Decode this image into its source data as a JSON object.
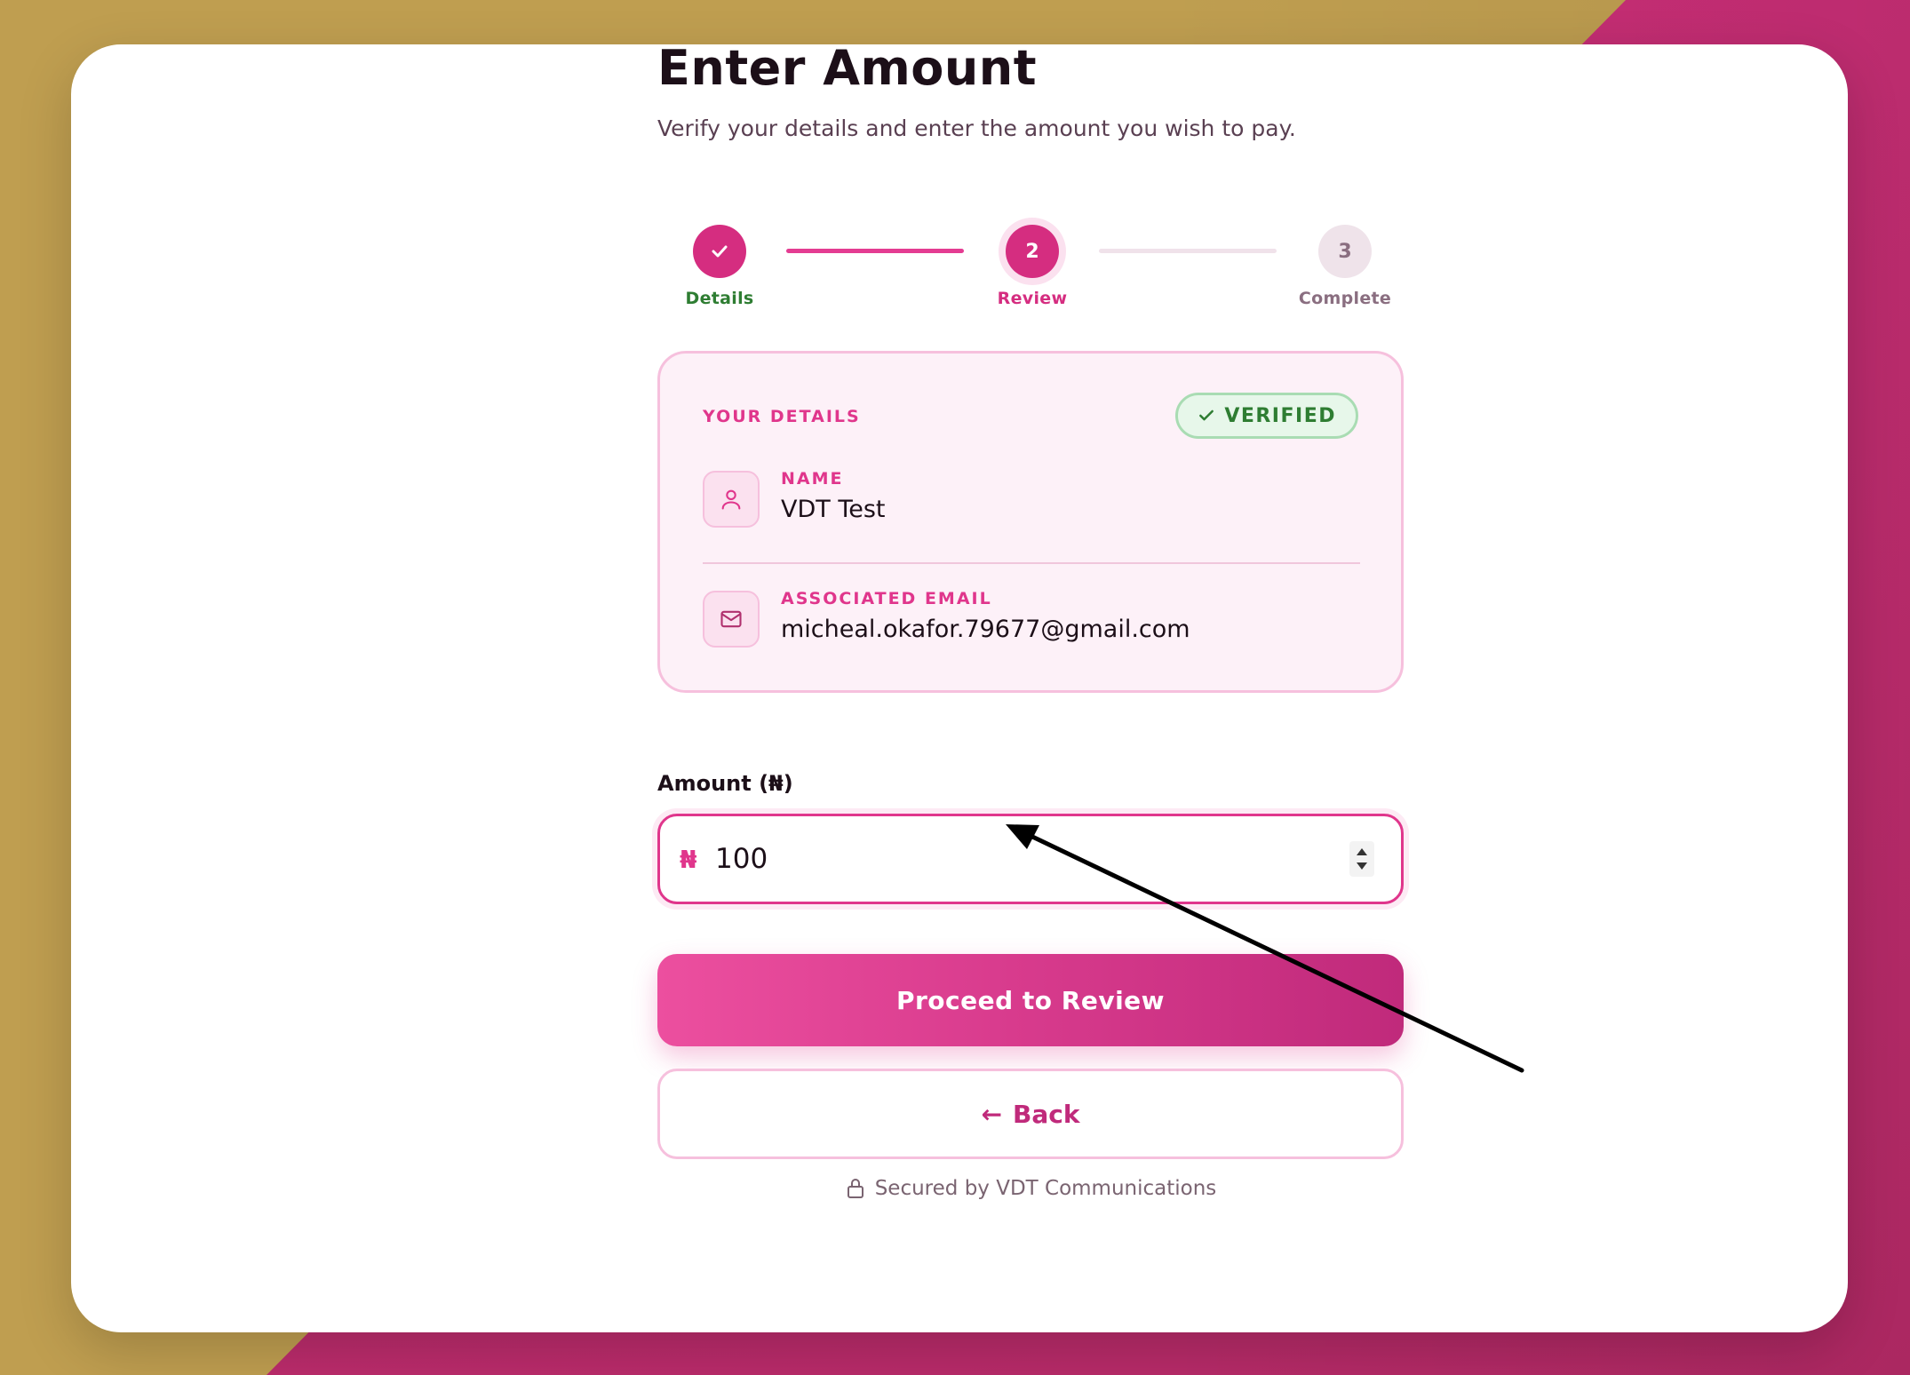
{
  "page": {
    "title": "Enter Amount",
    "subtitle": "Verify your details and enter the amount you wish to pay."
  },
  "stepper": {
    "steps": [
      {
        "number": "1",
        "label": "Details",
        "state": "done"
      },
      {
        "number": "2",
        "label": "Review",
        "state": "active"
      },
      {
        "number": "3",
        "label": "Complete",
        "state": "pending"
      }
    ]
  },
  "details": {
    "title": "YOUR DETAILS",
    "badge": "VERIFIED",
    "name_label": "NAME",
    "name_value": "VDT Test",
    "email_label": "ASSOCIATED EMAIL",
    "email_value": "micheal.okafor.79677@gmail.com"
  },
  "amount": {
    "label": "Amount (₦)",
    "currency_symbol": "₦",
    "value": "100"
  },
  "buttons": {
    "proceed": "Proceed to Review",
    "back_arrow": "←",
    "back": "Back"
  },
  "footer": {
    "text": "Secured by VDT Communications"
  },
  "icons": {
    "check": "check-icon",
    "user": "user-icon",
    "mail": "mail-icon",
    "lock": "lock-icon"
  },
  "colors": {
    "accent": "#e0368c",
    "success": "#2e7d32",
    "background_gold": "#bf9e50",
    "background_pink": "#c8307a"
  }
}
